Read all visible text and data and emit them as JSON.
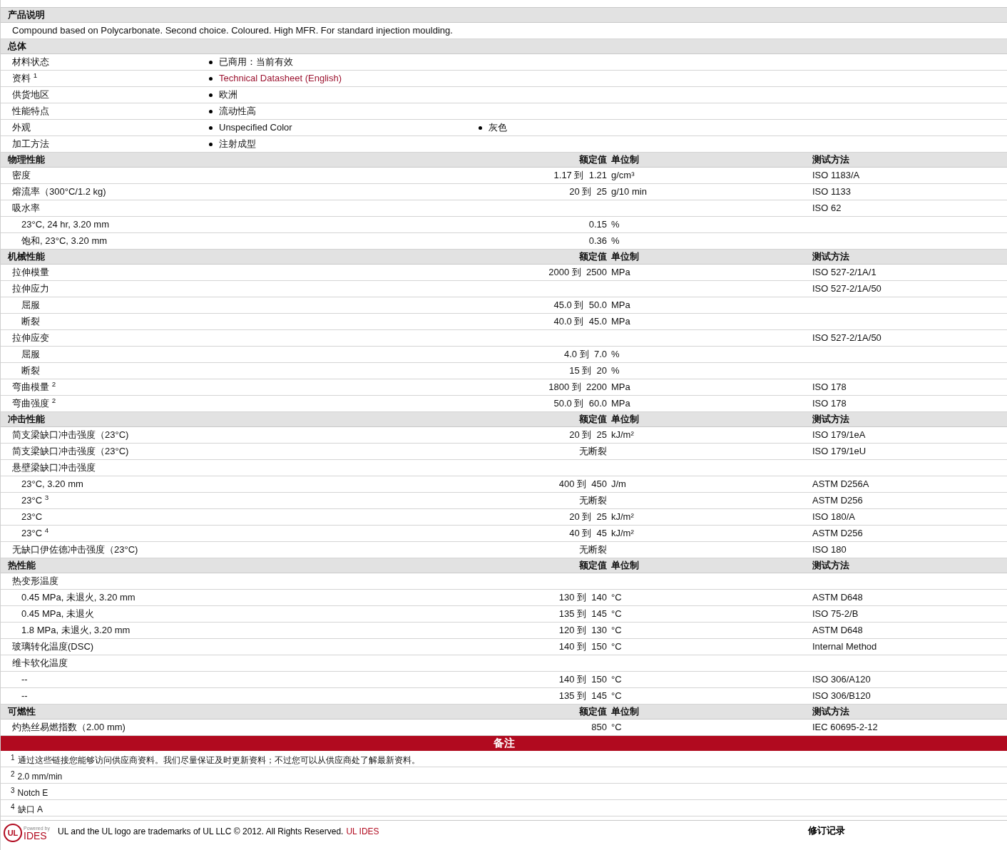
{
  "description": {
    "title": "产品说明",
    "text": "Compound based on Polycarbonate. Second choice. Coloured. High MFR. For standard injection moulding."
  },
  "general": {
    "title": "总体",
    "rows": [
      {
        "label": "材料状态",
        "values": [
          {
            "text": "已商用：当前有效",
            "kind": "text"
          }
        ]
      },
      {
        "label": "资料 $^{1}$",
        "values": [
          {
            "text": "Technical Datasheet (English)",
            "kind": "link"
          }
        ]
      },
      {
        "label": "供货地区",
        "values": [
          {
            "text": "欧洲",
            "kind": "text"
          }
        ]
      },
      {
        "label": "性能特点",
        "values": [
          {
            "text": "流动性高",
            "kind": "text"
          }
        ]
      },
      {
        "label": "外观",
        "values": [
          {
            "text": "Unspecified Color",
            "kind": "text"
          },
          {
            "text": "灰色",
            "kind": "text"
          }
        ]
      },
      {
        "label": "加工方法",
        "values": [
          {
            "text": "注射成型",
            "kind": "text"
          }
        ]
      }
    ]
  },
  "sections": [
    {
      "title": "物理性能",
      "columns": [
        "额定值",
        "单位制",
        "测试方法"
      ],
      "rows": [
        {
          "label": "密度",
          "value": "1.17 到  1.21",
          "unit": "g/cm³",
          "method": "ISO 1183/A"
        },
        {
          "label": "熔流率（300°C/1.2 kg)",
          "value": "20 到  25",
          "unit": "g/10 min",
          "method": "ISO 1133"
        },
        {
          "label": "吸水率",
          "method": "ISO 62",
          "children": [
            {
              "label": "23°C, 24 hr, 3.20 mm",
              "value": "0.15",
              "unit": "%"
            },
            {
              "label": "饱和, 23°C, 3.20 mm",
              "value": "0.36",
              "unit": "%"
            }
          ]
        }
      ]
    },
    {
      "title": "机械性能",
      "columns": [
        "额定值",
        "单位制",
        "测试方法"
      ],
      "rows": [
        {
          "label": "拉伸模量",
          "value": "2000 到  2500",
          "unit": "MPa",
          "method": "ISO 527-2/1A/1"
        },
        {
          "label": "拉伸应力",
          "method": "ISO 527-2/1A/50",
          "children": [
            {
              "label": "屈服",
              "value": "45.0 到  50.0",
              "unit": "MPa"
            },
            {
              "label": "断裂",
              "value": "40.0 到  45.0",
              "unit": "MPa"
            }
          ]
        },
        {
          "label": "拉伸应变",
          "method": "ISO 527-2/1A/50",
          "children": [
            {
              "label": "屈服",
              "value": "4.0 到  7.0",
              "unit": "%"
            },
            {
              "label": "断裂",
              "value": "15 到  20",
              "unit": "%"
            }
          ]
        },
        {
          "label": "弯曲模量 $^{2}$",
          "value": "1800 到  2200",
          "unit": "MPa",
          "method": "ISO 178"
        },
        {
          "label": "弯曲强度 $^{2}$",
          "value": "50.0 到  60.0",
          "unit": "MPa",
          "method": "ISO 178"
        }
      ]
    },
    {
      "title": "冲击性能",
      "columns": [
        "额定值",
        "单位制",
        "测试方法"
      ],
      "rows": [
        {
          "label": "简支梁缺口冲击强度（23°C)",
          "value": "20 到  25",
          "unit": "kJ/m²",
          "method": "ISO 179/1eA"
        },
        {
          "label": "简支梁缺口冲击强度（23°C)",
          "value": "无断裂",
          "method": "ISO 179/1eU"
        },
        {
          "label": "悬壁梁缺口冲击强度",
          "children": [
            {
              "label": "23°C, 3.20 mm",
              "value": "400 到  450",
              "unit": "J/m",
              "method": "ASTM D256A"
            },
            {
              "label": "23°C $^{3}$",
              "value": "无断裂",
              "method": "ASTM D256"
            },
            {
              "label": "23°C",
              "value": "20 到  25",
              "unit": "kJ/m²",
              "method": "ISO 180/A"
            },
            {
              "label": "23°C $^{4}$",
              "value": "40 到  45",
              "unit": "kJ/m²",
              "method": "ASTM D256"
            }
          ]
        },
        {
          "label": "无缺口伊佐德冲击强度（23°C)",
          "value": "无断裂",
          "method": "ISO 180"
        }
      ]
    },
    {
      "title": "热性能",
      "columns": [
        "额定值",
        "单位制",
        "测试方法"
      ],
      "rows": [
        {
          "label": "热变形温度",
          "children": [
            {
              "label": "0.45 MPa, 未退火, 3.20 mm",
              "value": "130 到  140",
              "unit": "°C",
              "method": "ASTM D648"
            },
            {
              "label": "0.45 MPa, 未退火",
              "value": "135 到  145",
              "unit": "°C",
              "method": "ISO 75-2/B"
            },
            {
              "label": "1.8 MPa, 未退火, 3.20 mm",
              "value": "120 到  130",
              "unit": "°C",
              "method": "ASTM D648"
            }
          ]
        },
        {
          "label": "玻璃转化温度(DSC)",
          "value": "140 到  150",
          "unit": "°C",
          "method": "Internal Method"
        },
        {
          "label": "维卡软化温度",
          "children": [
            {
              "label": "--",
              "value": "140 到  150",
              "unit": "°C",
              "method": "ISO 306/A120"
            },
            {
              "label": "--",
              "value": "135 到  145",
              "unit": "°C",
              "method": "ISO 306/B120"
            }
          ]
        }
      ]
    },
    {
      "title": "可燃性",
      "columns": [
        "额定值",
        "单位制",
        "测试方法"
      ],
      "rows": [
        {
          "label": "灼热丝易燃指数（2.00 mm)",
          "value": "850",
          "unit": "°C",
          "method": "IEC 60695-2-12"
        }
      ]
    }
  ],
  "notes": {
    "title": "备注",
    "items": [
      {
        "mark": "1",
        "text": "通过这些链接您能够访问供应商资料。我们尽量保证及时更新资料；不过您可以从供应商处了解最新资料。"
      },
      {
        "mark": "2",
        "text": "2.0 mm/min"
      },
      {
        "mark": "3",
        "text": "Notch E"
      },
      {
        "mark": "4",
        "text": "缺口  A"
      }
    ]
  },
  "footer": {
    "logo_top": "Powered by",
    "logo_mark": "UL",
    "logo_bottom": "IDES",
    "text": "UL and the UL logo are trademarks of UL LLC © 2012. All Rights Reserved.",
    "link": "UL IDES",
    "revision_title": "修订记录"
  }
}
